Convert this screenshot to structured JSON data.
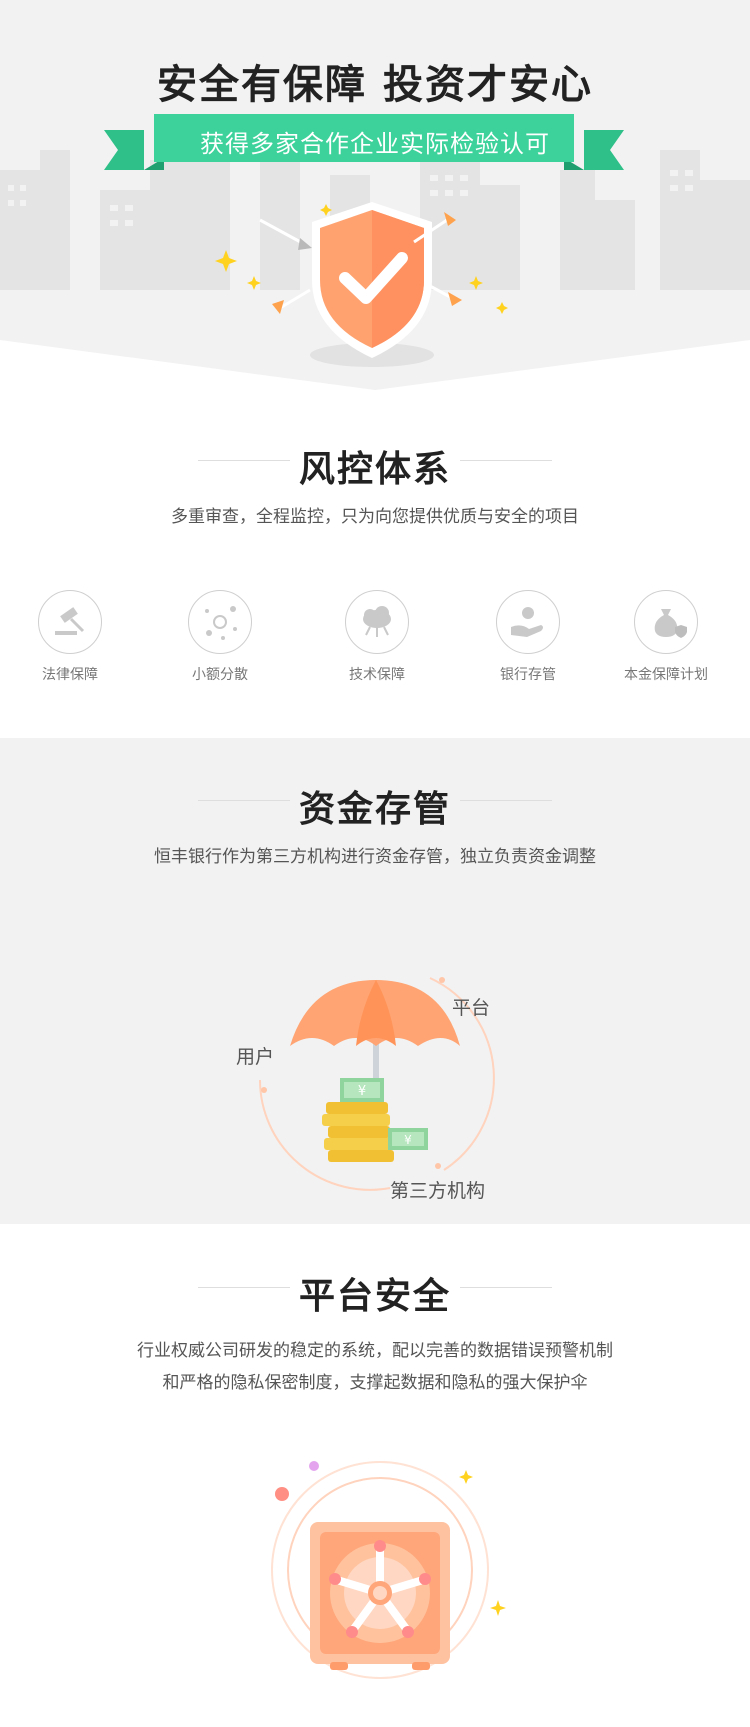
{
  "hero": {
    "title": "安全有保障  投资才安心",
    "ribbon_text": "获得多家合作企业实际检验认可"
  },
  "risk_control": {
    "title": "风控体系",
    "description": "多重审查，全程监控，只为向您提供优质与安全的项目",
    "features": [
      {
        "label": "法律保障",
        "icon": "gavel-icon"
      },
      {
        "label": "小额分散",
        "icon": "scatter-dots-icon"
      },
      {
        "label": "技术保障",
        "icon": "cloud-tech-icon"
      },
      {
        "label": "银行存管",
        "icon": "hand-coin-icon"
      },
      {
        "label": "本金保障计划",
        "icon": "money-bag-icon"
      }
    ]
  },
  "fund_custody": {
    "title": "资金存管",
    "description": "恒丰银行作为第三方机构进行资金存管，独立负责资金调整",
    "diagram_labels": {
      "platform": "平台",
      "user": "用户",
      "third_party": "第三方机构"
    },
    "currency_symbol": "¥"
  },
  "platform_security": {
    "title": "平台安全",
    "description_line1": "行业权威公司研发的稳定的系统，配以完善的数据错误预警机制",
    "description_line2": "和严格的隐私保密制度，支撑起数据和隐私的强大保护伞"
  },
  "colors": {
    "accent_green": "#3dd29b",
    "shield_orange": "#ff9e6b",
    "title_dark": "#222222",
    "section_gray": "#f2f2f2"
  }
}
